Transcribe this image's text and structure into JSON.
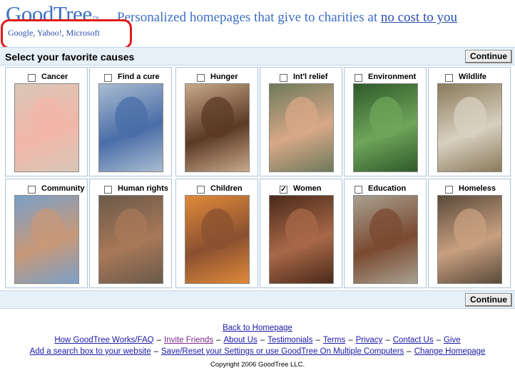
{
  "header": {
    "logo": "GoodTree",
    "logo_tm": "™",
    "tagline_prefix": "Personalized homepages that give to charities at ",
    "tagline_link": "no cost to you",
    "engines": "Google, Yahoo!, Microsoft"
  },
  "selector": {
    "title": "Select your favorite causes",
    "continue_label": "Continue"
  },
  "causes": [
    {
      "label": "Cancer",
      "checked": false,
      "photo_bg": "#d9c7b8",
      "photo_fg": "#f2b6a8"
    },
    {
      "label": "Find a cure",
      "checked": false,
      "photo_bg": "#a9bcd0",
      "photo_fg": "#4a6da8"
    },
    {
      "label": "Hunger",
      "checked": false,
      "photo_bg": "#c9a98a",
      "photo_fg": "#5b3a24"
    },
    {
      "label": "Int'l relief",
      "checked": false,
      "photo_bg": "#6d7a5a",
      "photo_fg": "#d8a888"
    },
    {
      "label": "Environment",
      "checked": false,
      "photo_bg": "#2f5a2a",
      "photo_fg": "#6fa55a"
    },
    {
      "label": "Wildlife",
      "checked": false,
      "photo_bg": "#8a7a5a",
      "photo_fg": "#d8d0c0"
    },
    {
      "label": "Community",
      "checked": false,
      "photo_bg": "#7aa0c8",
      "photo_fg": "#c89878"
    },
    {
      "label": "Human rights",
      "checked": false,
      "photo_bg": "#6a5a4a",
      "photo_fg": "#a87858"
    },
    {
      "label": "Children",
      "checked": false,
      "photo_bg": "#e08a3a",
      "photo_fg": "#8a5030"
    },
    {
      "label": "Women",
      "checked": true,
      "photo_bg": "#4a2a1a",
      "photo_fg": "#a86848"
    },
    {
      "label": "Education",
      "checked": false,
      "photo_bg": "#a8a090",
      "photo_fg": "#7a4a30"
    },
    {
      "label": "Homeless",
      "checked": false,
      "photo_bg": "#5a4a3a",
      "photo_fg": "#c8a080"
    }
  ],
  "footer": {
    "back": "Back to Homepage",
    "links_row1": [
      "How GoodTree Works/FAQ",
      "Invite Friends",
      "About Us",
      "Testimonials",
      "Terms",
      "Privacy",
      "Contact Us",
      "Give"
    ],
    "links_row2": [
      "Add a search box to your website",
      "Save/Reset your Settings or use GoodTree On Multiple Computers",
      "Change Homepage"
    ],
    "separator": "–",
    "copyright": "Copyright 2006 GoodTree LLC."
  }
}
